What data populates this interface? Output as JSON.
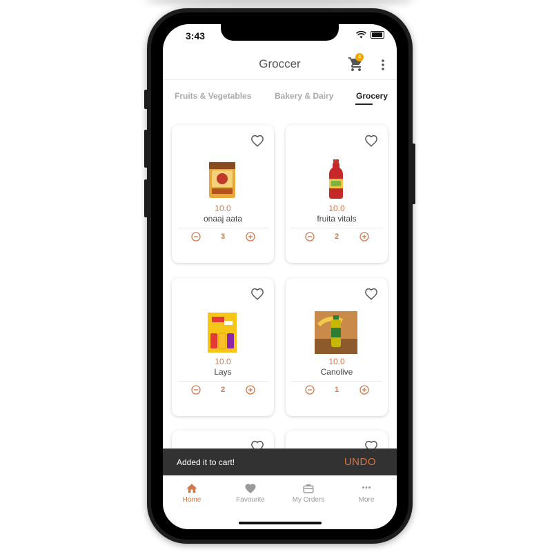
{
  "status_bar": {
    "time": "3:43"
  },
  "app_bar": {
    "title": "Groccer",
    "cart_count": "4"
  },
  "tabs": [
    {
      "label": "Fruits & Vegetables",
      "active": false
    },
    {
      "label": "Bakery & Dairy",
      "active": false
    },
    {
      "label": "Grocery",
      "active": true
    }
  ],
  "products": [
    {
      "price": "10.0",
      "name": "onaaj aata",
      "quantity": "3",
      "favourite": false,
      "image": "flour-bag"
    },
    {
      "price": "10.0",
      "name": "fruita vitals",
      "quantity": "2",
      "favourite": false,
      "image": "juice-bottle"
    },
    {
      "price": "10.0",
      "name": "Lays",
      "quantity": "2",
      "favourite": false,
      "image": "chips-pack"
    },
    {
      "price": "10.0",
      "name": "Canolive",
      "quantity": "1",
      "favourite": false,
      "image": "oil-bottle"
    }
  ],
  "snackbar": {
    "message": "Added it to cart!",
    "action": "UNDO"
  },
  "bottom_nav": [
    {
      "label": "Home",
      "icon": "home-icon",
      "active": true
    },
    {
      "label": "Favourite",
      "icon": "heart-icon",
      "active": false
    },
    {
      "label": "My Orders",
      "icon": "briefcase-icon",
      "active": false
    },
    {
      "label": "More",
      "icon": "more-horizontal-icon",
      "active": false
    }
  ],
  "colors": {
    "accent": "#d3774a",
    "badge": "#f0a500",
    "snackbar": "#323232"
  }
}
